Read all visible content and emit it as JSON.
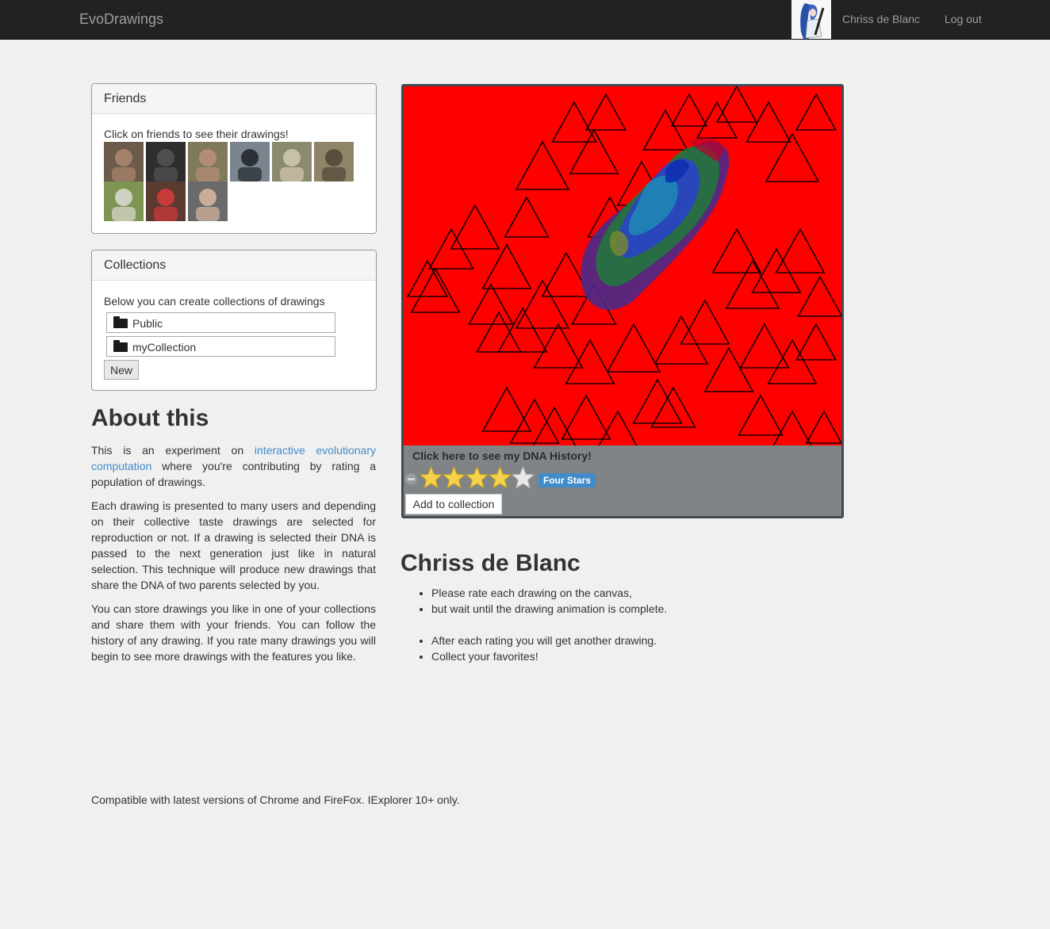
{
  "navbar": {
    "brand": "EvoDrawings",
    "user_name": "Chriss de Blanc",
    "logout": "Log out"
  },
  "friends": {
    "title": "Friends",
    "instructions": "Click on friends to see their drawings!",
    "thumbnails": [
      {
        "bg": "#6b5b4a",
        "accent": "#a5806a"
      },
      {
        "bg": "#2e2e2e",
        "accent": "#4f4f4f"
      },
      {
        "bg": "#7f7a5c",
        "accent": "#b28c74"
      },
      {
        "bg": "#7a8590",
        "accent": "#2c3138"
      },
      {
        "bg": "#8a8a6e",
        "accent": "#c9c0a9"
      },
      {
        "bg": "#8f8468",
        "accent": "#5a4d3d"
      },
      {
        "bg": "#7d9550",
        "accent": "#cfd2c2"
      },
      {
        "bg": "#5b3a2f",
        "accent": "#c63a3a"
      },
      {
        "bg": "#6a6a6a",
        "accent": "#c9ad98"
      }
    ]
  },
  "collections": {
    "title": "Collections",
    "instructions": "Below you can create collections of drawings",
    "items": [
      "Public",
      "myCollection"
    ],
    "new_button": "New"
  },
  "about": {
    "title": "About this",
    "p1_before": "This is an experiment on ",
    "p1_link": "interactive evolutionary computation",
    "p1_after": " where you're contributing by rating a population of drawings.",
    "p2": "Each drawing is presented to many users and depending on their collective taste drawings are selected for reproduction or not. If a drawing is selected their DNA is passed to the next generation just like in natural selection. This technique will produce new drawings that share the DNA of two parents selected by you.",
    "p3": "You can store drawings you like in one of your collections and share them with your friends. You can follow the history of any drawing. If you rate many drawings you will begin to see more drawings with the features you like."
  },
  "drawing": {
    "background_color": "#ff0000",
    "dna_link": "Click here to see my DNA History!",
    "rating": 4,
    "rating_max": 5,
    "rating_label": "Four Stars",
    "add_button": "Add to collection"
  },
  "user_section": {
    "title": "Chriss de Blanc",
    "tips": [
      "Please rate each drawing on the canvas,",
      "but wait until the drawing animation is complete.",
      "After each rating you will get another drawing.",
      "Collect your favorites!"
    ]
  },
  "footer": "Compatible with latest versions of Chrome and FireFox. IExplorer 10+ only."
}
